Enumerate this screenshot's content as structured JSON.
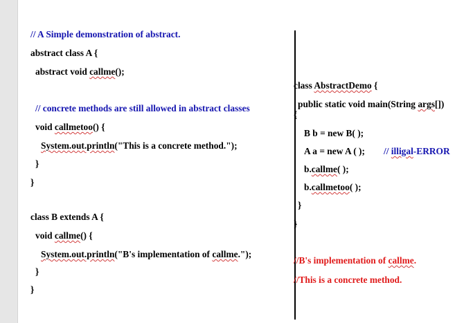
{
  "left_column": {
    "comment_simple": "// A Simple demonstration of abstract.",
    "class_a_decl": "abstract class A {",
    "abstract_method_pre": "abstract void ",
    "abstract_method_name": "callme",
    "abstract_method_post": "();",
    "comment_concrete": "// concrete methods are still allowed in abstract classes",
    "callmetoo_pre": "void ",
    "callmetoo_name": "callmetoo",
    "callmetoo_post": "() {",
    "println1_qual": "System.out.println",
    "println1_rest": "(\"This is a concrete method.\");",
    "close_brace_inner": "}",
    "close_brace_class_a": "}",
    "class_b_decl": "class B extends A {",
    "callme_impl_pre": "void ",
    "callme_impl_name": "callme",
    "callme_impl_post": "() {",
    "println2_qual": "System.out.println",
    "println2_mid": "(\"B's implementation of ",
    "println2_word": "callme",
    "println2_end": ".\");",
    "close_brace_callme": "}",
    "close_brace_class_b": "}"
  },
  "right_column": {
    "class_demo_pre": "class ",
    "class_demo_name": "AbstractDemo",
    "class_demo_post": " {",
    "main_pre": "public static void main(String ",
    "main_args": "args",
    "main_post": "[])",
    "open_brace": "{",
    "line_b": "B b = new B( );",
    "line_a_code": "A a = new A ( );",
    "line_a_comment_prefix": "// ",
    "line_a_comment_word": "illigal",
    "line_a_comment_rest": "-ERROR",
    "call_b_callme_pre": "b.",
    "call_b_callme_name": "callme",
    "call_b_callme_post": "( );",
    "call_b_callmetoo_pre": "b.",
    "call_b_callmetoo_name": "callmetoo",
    "call_b_callmetoo_post": "( );",
    "close_brace_main": "}",
    "close_brace_class": "}",
    "output1_pre": "//B's implementation of ",
    "output1_word": "callme",
    "output1_end": ".",
    "output2": "//This is a concrete method."
  },
  "colors": {
    "code": "#000000",
    "comment": "#1515b0",
    "output": "#e01b1b",
    "spellcheck": "#d23c3c"
  }
}
